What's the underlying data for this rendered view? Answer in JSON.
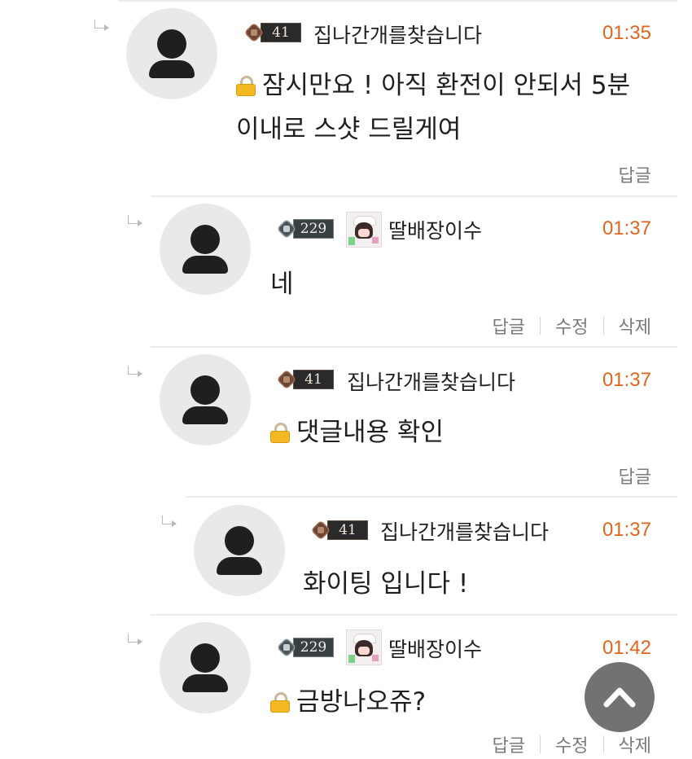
{
  "comments": [
    {
      "level": "41",
      "nickname": "집나간개를찾습니다",
      "time": "01:35",
      "text_line1": "잠시만요 ! 아직 환전이 안되서 5분",
      "text_line2": "이내로 스샷 드릴게여",
      "secret": true,
      "actions": [
        "답글"
      ]
    },
    {
      "level": "229",
      "nickname": "딸배장이수",
      "time": "01:37",
      "text_line1": "네",
      "secret": false,
      "actions": [
        "답글",
        "수정",
        "삭제"
      ]
    },
    {
      "level": "41",
      "nickname": "집나간개를찾습니다",
      "time": "01:37",
      "text_line1": "댓글내용 확인",
      "secret": true,
      "actions": [
        "답글"
      ]
    },
    {
      "level": "41",
      "nickname": "집나간개를찾습니다",
      "time": "01:37",
      "text_line1": "화이팅 입니다 !",
      "secret": false,
      "actions": []
    },
    {
      "level": "229",
      "nickname": "딸배장이수",
      "time": "01:42",
      "text_line1": "금방나오쥬?",
      "secret": true,
      "actions": [
        "답글",
        "수정",
        "삭제"
      ]
    }
  ],
  "icons": {
    "reply_indicator": "reply-arrow-icon",
    "avatar": "default-user-avatar",
    "secret": "lock-icon",
    "scroll_top": "chevron-up-icon"
  },
  "colors": {
    "time": "#e0651d",
    "avatar_bg": "#e9e9ea",
    "scroll_button": "#5f5f5f"
  }
}
